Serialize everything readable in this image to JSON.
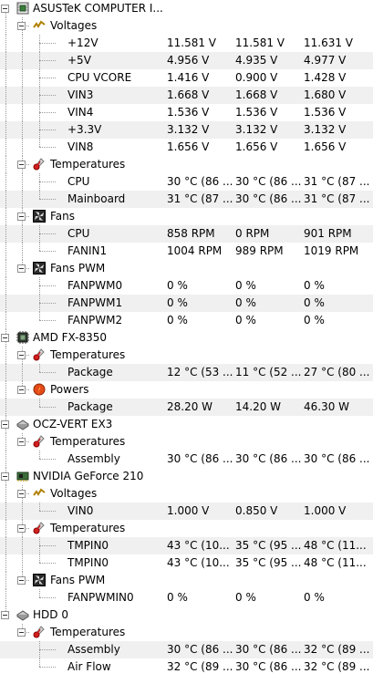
{
  "window": {
    "width": 409,
    "height": 750
  },
  "icons": {
    "hardware_board": "motherboard-chip-icon",
    "cpu": "cpu-chip-icon",
    "drive": "drive-icon",
    "gpu": "graphics-card-icon",
    "voltages": "lightning-icon",
    "temperatures": "thermometer-icon",
    "fans": "fan-icon",
    "powers": "flame-icon"
  },
  "hardware": [
    {
      "name": "ASUSTeK COMPUTER I...",
      "icon": "board",
      "groups": [
        {
          "name": "Voltages",
          "icon": "volt",
          "sensors": [
            {
              "name": "+12V",
              "value": "11.581 V",
              "min": "11.581 V",
              "max": "11.631 V"
            },
            {
              "name": "+5V",
              "value": "4.956 V",
              "min": "4.935 V",
              "max": "4.977 V"
            },
            {
              "name": "CPU VCORE",
              "value": "1.416 V",
              "min": "0.900 V",
              "max": "1.428 V"
            },
            {
              "name": "VIN3",
              "value": "1.668 V",
              "min": "1.668 V",
              "max": "1.680 V"
            },
            {
              "name": "VIN4",
              "value": "1.536 V",
              "min": "1.536 V",
              "max": "1.536 V"
            },
            {
              "name": "+3.3V",
              "value": "3.132 V",
              "min": "3.132 V",
              "max": "3.132 V"
            },
            {
              "name": "VIN8",
              "value": "1.656 V",
              "min": "1.656 V",
              "max": "1.656 V"
            }
          ]
        },
        {
          "name": "Temperatures",
          "icon": "temp",
          "sensors": [
            {
              "name": "CPU",
              "value": "30 °C (86 ...",
              "min": "30 °C (86 ...",
              "max": "31 °C (87 ..."
            },
            {
              "name": "Mainboard",
              "value": "31 °C (87 ...",
              "min": "30 °C (86 ...",
              "max": "31 °C (87 ..."
            }
          ]
        },
        {
          "name": "Fans",
          "icon": "fan",
          "sensors": [
            {
              "name": "CPU",
              "value": "858 RPM",
              "min": "0 RPM",
              "max": "901 RPM"
            },
            {
              "name": "FANIN1",
              "value": "1004 RPM",
              "min": "989 RPM",
              "max": "1019 RPM"
            }
          ]
        },
        {
          "name": "Fans PWM",
          "icon": "fan",
          "sensors": [
            {
              "name": "FANPWM0",
              "value": "0 %",
              "min": "0 %",
              "max": "0 %"
            },
            {
              "name": "FANPWM1",
              "value": "0 %",
              "min": "0 %",
              "max": "0 %"
            },
            {
              "name": "FANPWM2",
              "value": "0 %",
              "min": "0 %",
              "max": "0 %"
            }
          ]
        }
      ]
    },
    {
      "name": "AMD FX-8350",
      "icon": "cpu",
      "groups": [
        {
          "name": "Temperatures",
          "icon": "temp",
          "sensors": [
            {
              "name": "Package",
              "value": "12 °C (53 ...",
              "min": "11 °C (52 ...",
              "max": "27 °C (80 ..."
            }
          ]
        },
        {
          "name": "Powers",
          "icon": "power",
          "sensors": [
            {
              "name": "Package",
              "value": "28.20 W",
              "min": "14.20 W",
              "max": "46.30 W"
            }
          ]
        }
      ]
    },
    {
      "name": "OCZ-VERT EX3",
      "icon": "drive",
      "groups": [
        {
          "name": "Temperatures",
          "icon": "temp",
          "sensors": [
            {
              "name": "Assembly",
              "value": "30 °C (86 ...",
              "min": "30 °C (86 ...",
              "max": "30 °C (86 ..."
            }
          ]
        }
      ]
    },
    {
      "name": "NVIDIA GeForce 210",
      "icon": "gpu",
      "groups": [
        {
          "name": "Voltages",
          "icon": "volt",
          "sensors": [
            {
              "name": "VIN0",
              "value": "1.000 V",
              "min": "0.850 V",
              "max": "1.000 V"
            }
          ]
        },
        {
          "name": "Temperatures",
          "icon": "temp",
          "sensors": [
            {
              "name": "TMPIN0",
              "value": "43 °C (10...",
              "min": "35 °C (95 ...",
              "max": "48 °C (11..."
            },
            {
              "name": "TMPIN0",
              "value": "43 °C (10...",
              "min": "35 °C (95 ...",
              "max": "48 °C (11..."
            }
          ]
        },
        {
          "name": "Fans PWM",
          "icon": "fan",
          "sensors": [
            {
              "name": "FANPWMIN0",
              "value": "0 %",
              "min": "0 %",
              "max": "0 %"
            }
          ]
        }
      ]
    },
    {
      "name": "HDD 0",
      "icon": "drive",
      "groups": [
        {
          "name": "Temperatures",
          "icon": "temp",
          "sensors": [
            {
              "name": "Assembly",
              "value": "30 °C (86 ...",
              "min": "30 °C (86 ...",
              "max": "32 °C (89 ..."
            },
            {
              "name": "Air Flow",
              "value": "32 °C (89 ...",
              "min": "30 °C (86 ...",
              "max": "32 °C (89 ..."
            }
          ]
        }
      ]
    }
  ]
}
